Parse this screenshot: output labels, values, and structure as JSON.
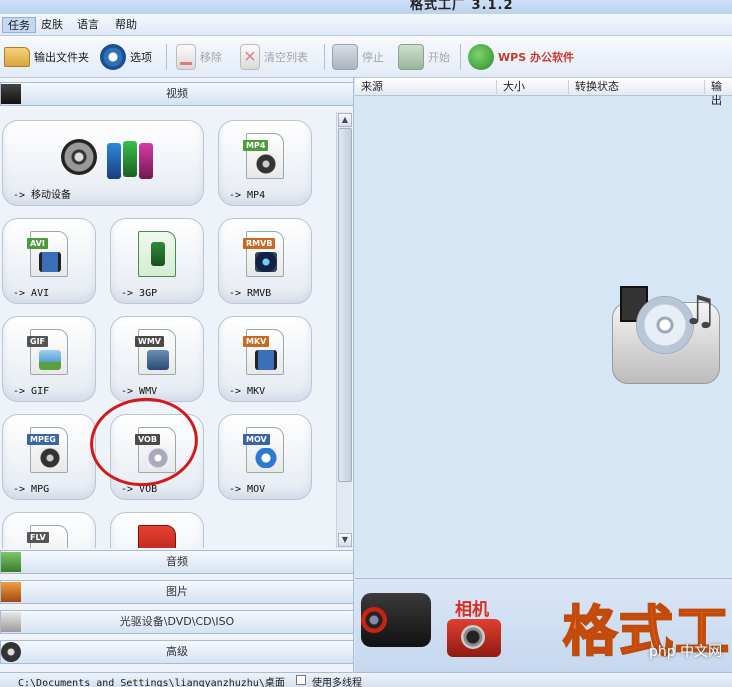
{
  "window": {
    "title": "格式工厂 3.1.2"
  },
  "menu": [
    {
      "label": "任务",
      "active": true
    },
    {
      "label": "皮肤",
      "active": false
    },
    {
      "label": "语言",
      "active": false
    },
    {
      "label": "帮助",
      "active": false
    }
  ],
  "toolbar": {
    "output_folder": "输出文件夹",
    "options": "选项",
    "remove": "移除",
    "clear_list": "清空列表",
    "stop": "停止",
    "start": "开始",
    "wps": "WPS 办公软件"
  },
  "sections": {
    "video": "视频",
    "audio": "音频",
    "image": "图片",
    "rom": "光驱设备\\DVD\\CD\\ISO",
    "advanced": "高级"
  },
  "tiles": [
    {
      "label": "-> 移动设备",
      "tag": "",
      "color": ""
    },
    {
      "label": "-> MP4",
      "tag": "MP4",
      "color": "#4f9a3a"
    },
    {
      "label": "-> AVI",
      "tag": "AVI",
      "color": "#4f9a3a"
    },
    {
      "label": "-> 3GP",
      "tag": "",
      "color": "#2f8a3a"
    },
    {
      "label": "-> RMVB",
      "tag": "RMVB",
      "color": "#c96a22"
    },
    {
      "label": "-> GIF",
      "tag": "GIF",
      "color": "#555555"
    },
    {
      "label": "-> WMV",
      "tag": "WMV",
      "color": "#4a4a4a"
    },
    {
      "label": "-> MKV",
      "tag": "MKV",
      "color": "#c96a22"
    },
    {
      "label": "-> MPG",
      "tag": "MPEG",
      "color": "#3a64a8"
    },
    {
      "label": "-> VOB",
      "tag": "VOB",
      "color": "#4a4a4a"
    },
    {
      "label": "-> MOV",
      "tag": "MOV",
      "color": "#3a64a8"
    },
    {
      "label": "",
      "tag": "FLV",
      "color": "#555555"
    },
    {
      "label": "",
      "tag": "",
      "color": "#d9302a"
    }
  ],
  "list_columns": [
    "来源",
    "大小",
    "转换状态",
    "输出"
  ],
  "banner": {
    "camera_label": "相机",
    "brand": "格式工",
    "watermark": "php 中文网"
  },
  "status": {
    "path": "C:\\Documents and Settings\\liangyanzhuzhu\\桌面",
    "multithread": "使用多线程"
  }
}
